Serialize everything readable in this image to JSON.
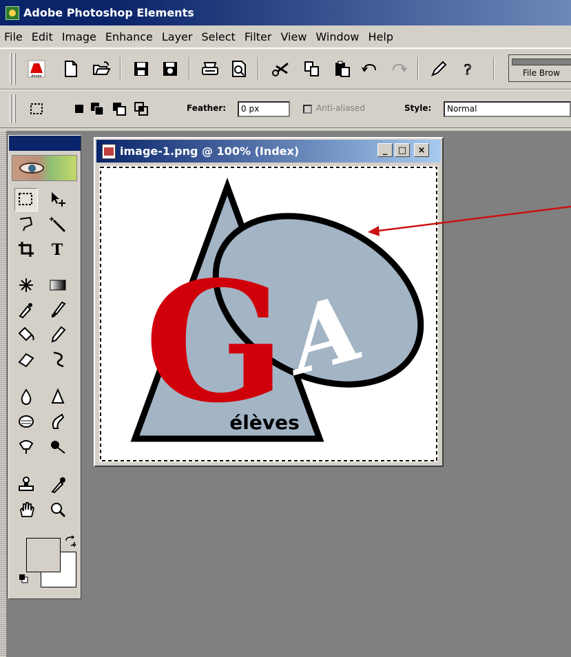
{
  "window": {
    "title": "Adobe Photoshop Elements"
  },
  "menu": {
    "items": [
      "File",
      "Edit",
      "Image",
      "Enhance",
      "Layer",
      "Select",
      "Filter",
      "View",
      "Window",
      "Help"
    ]
  },
  "toolbar": {
    "buttons": [
      "adobe-online-icon",
      "new-file-icon",
      "open-folder-icon",
      "save-icon",
      "save-for-web-icon",
      "print-icon",
      "print-preview-icon",
      "cut-icon",
      "copy-icon",
      "paste-icon",
      "undo-icon",
      "redo-icon",
      "edit-pencil-icon",
      "help-icon"
    ],
    "file_browser_label": "File Brow"
  },
  "options_bar": {
    "feather_label": "Feather:",
    "feather_value": "0 px",
    "anti_aliased_label": "Anti-aliased",
    "style_label": "Style:",
    "style_value": "Normal"
  },
  "document": {
    "title": "image-1.png @ 100% (Index)",
    "minimize": "_",
    "maximize": "□",
    "close": "×",
    "logo_text": "élèves",
    "logo_g": "G",
    "logo_a": "A"
  },
  "colors": {
    "title_bar": "#0a246a",
    "workspace": "#808080",
    "logo_red": "#d0000a",
    "logo_blue_grey": "#a3b4c5",
    "annotation_red": "#cc1111"
  }
}
